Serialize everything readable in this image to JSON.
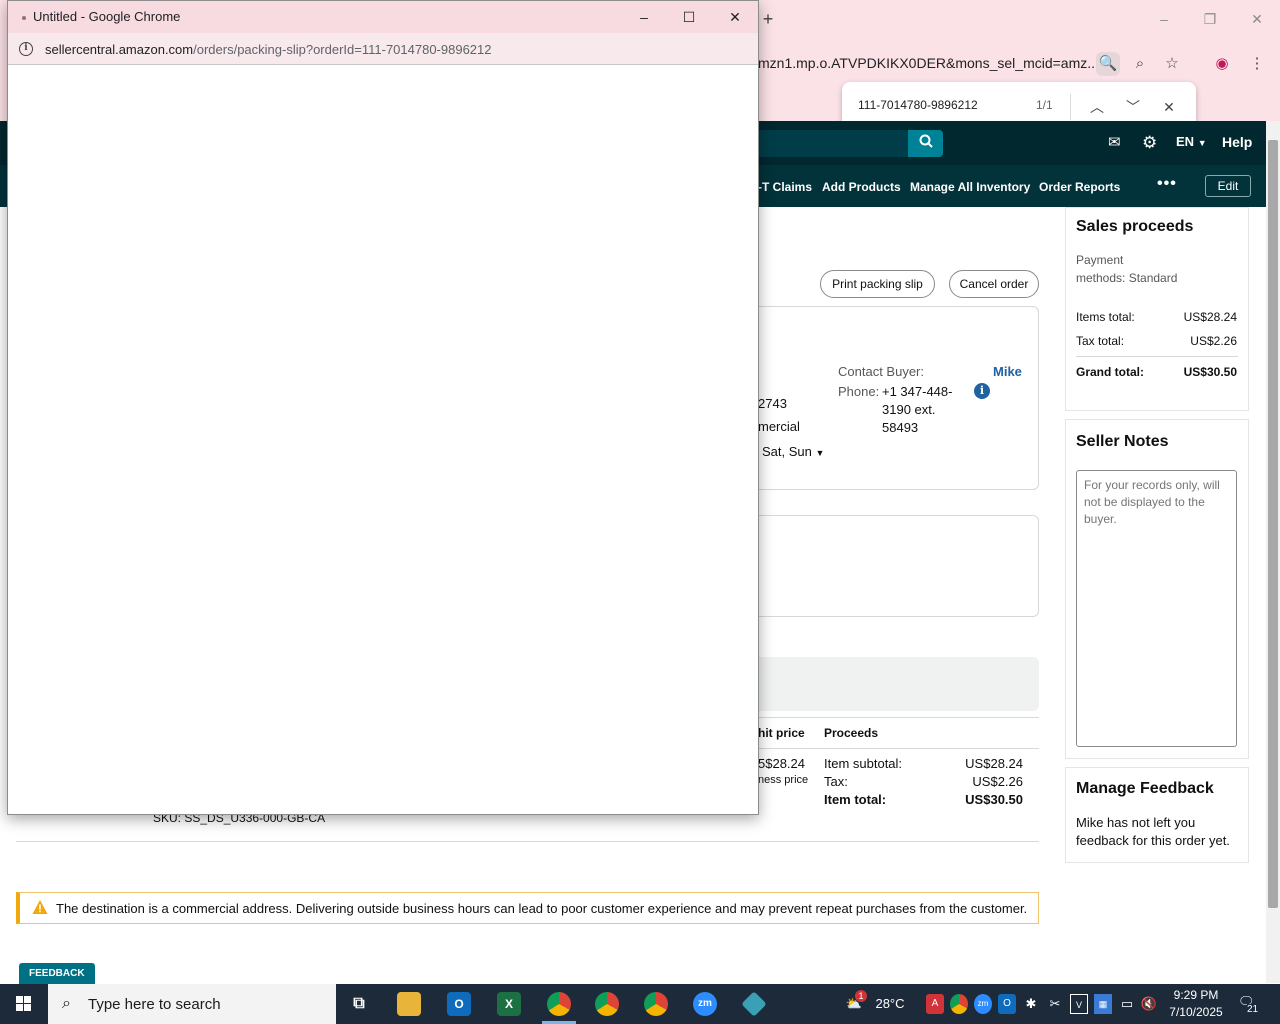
{
  "popup": {
    "title": "Untitled - Google Chrome",
    "url_host": "sellercentral.amazon.com",
    "url_path": "/orders/packing-slip?orderId=111-7014780-9896212"
  },
  "bg_browser": {
    "omnibox_fragment": "mzn1.mp.o.ATVPDKIKX0DER&mons_sel_mcid=amz...",
    "find_query": "111-7014780-9896212",
    "find_count": "1/1"
  },
  "sc_header": {
    "lang": "EN",
    "help": "Help",
    "nav_items": [
      "-T Claims",
      "Add Products",
      "Manage All Inventory",
      "Order Reports"
    ],
    "more": "•••",
    "edit": "Edit"
  },
  "order": {
    "print_packing_slip": "Print packing slip",
    "cancel_order": "Cancel order",
    "frag_2743": "2743",
    "frag_mercial": "mercial",
    "frag_days": "Sat, Sun",
    "contact_label": "Contact Buyer:",
    "buyer_name": "Mike",
    "phone_label": "Phone:",
    "phone_line1": "+1 347-448-",
    "phone_line2": "3190 ext.",
    "phone_line3": "58493",
    "col_unit_price": "hit price",
    "col_proceeds": "Proceeds",
    "unit_price_value": "5$28.24",
    "unit_price_note": "ness price",
    "item_subtotal_label": "Item subtotal:",
    "item_subtotal_value": "US$28.24",
    "tax_label": "Tax:",
    "tax_value": "US$2.26",
    "item_total_label": "Item total:",
    "item_total_value": "US$30.50",
    "sku": "SKU: SS_DS_U336-000-GB-CA"
  },
  "sales_proceeds": {
    "title": "Sales proceeds",
    "payment_line1": "Payment",
    "payment_line2": "methods: Standard",
    "items_total_label": "Items total:",
    "items_total_value": "US$28.24",
    "tax_total_label": "Tax total:",
    "tax_total_value": "US$2.26",
    "grand_total_label": "Grand total:",
    "grand_total_value": "US$30.50"
  },
  "seller_notes": {
    "title": "Seller Notes",
    "placeholder": "For your records only, will not be displayed to the buyer."
  },
  "manage_feedback": {
    "title": "Manage Feedback",
    "line1": "Mike has not left you",
    "line2": "feedback for this order yet."
  },
  "alert": {
    "text": "The destination is a commercial address. Delivering outside business hours can lead to poor customer experience and may prevent repeat purchases from the customer."
  },
  "feedback_tab": "FEEDBACK",
  "taskbar": {
    "search_placeholder": "Type here to search",
    "weather": "28°C",
    "weather_badge": "1",
    "time": "9:29 PM",
    "date": "7/10/2025",
    "notif_count": "21"
  },
  "colors": {
    "sc_header": "#00282e",
    "sc_nav": "#02323a",
    "accent_teal": "#008296",
    "link_blue": "#2162a1",
    "alert_border": "#f0a80c",
    "chrome_pink": "#fbe2e7",
    "taskbar": "#1c2a3a"
  }
}
